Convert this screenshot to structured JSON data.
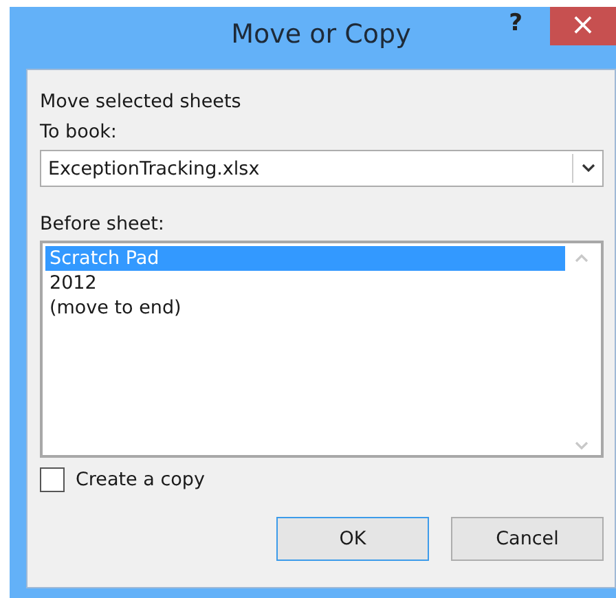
{
  "window": {
    "title": "Move or Copy",
    "help_button": "?",
    "close_button": "×"
  },
  "heading": "Move selected sheets",
  "to_book": {
    "label": "To book:",
    "value": "ExceptionTracking.xlsx"
  },
  "before_sheet": {
    "label": "Before sheet:",
    "items": [
      {
        "label": "Scratch Pad",
        "selected": true
      },
      {
        "label": "2012",
        "selected": false
      },
      {
        "label": "(move to end)",
        "selected": false
      }
    ]
  },
  "create_copy": {
    "label": "Create a copy",
    "checked": false
  },
  "buttons": [
    {
      "label": "OK",
      "kind": "default"
    },
    {
      "label": "Cancel",
      "kind": "normal"
    }
  ]
}
